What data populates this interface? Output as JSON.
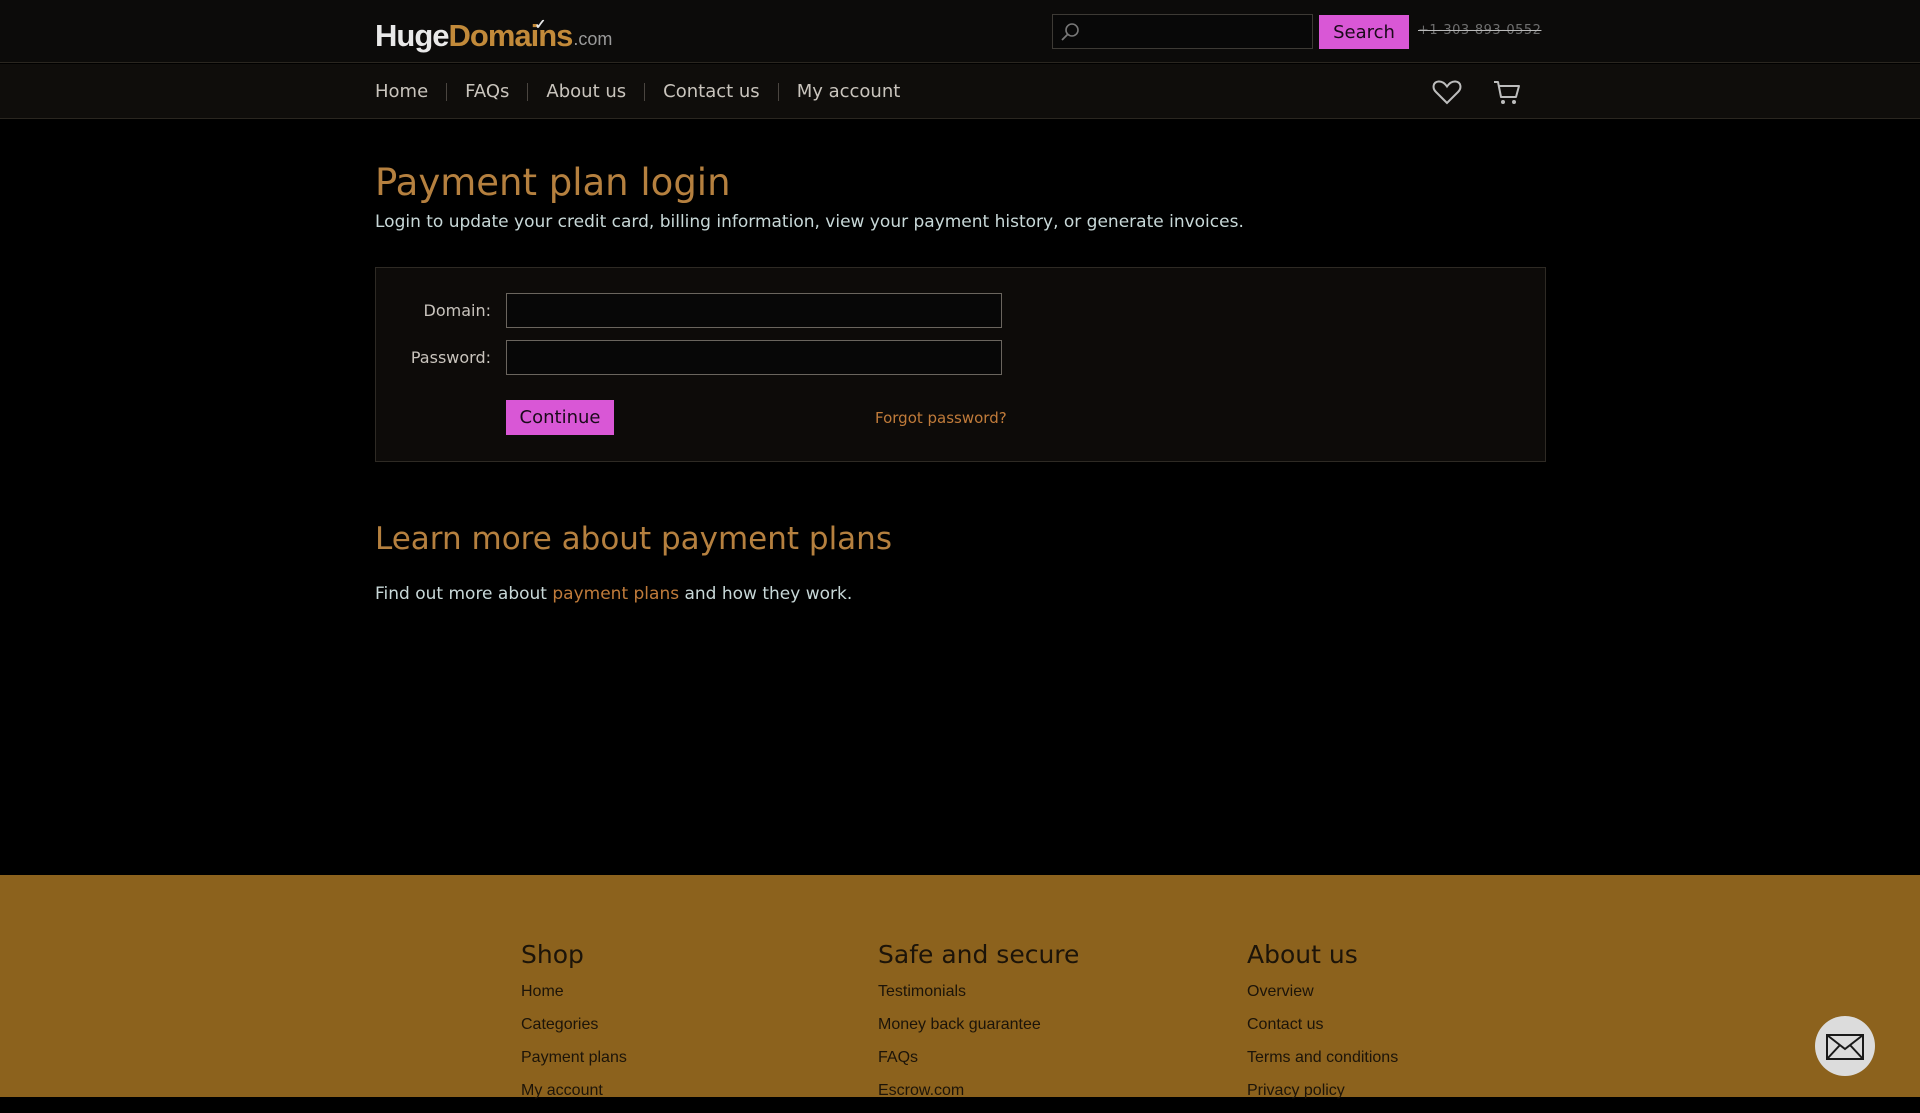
{
  "header": {
    "logo": {
      "huge": "Huge",
      "domains": "Domains",
      "com": ".com"
    },
    "search": {
      "placeholder": "",
      "button_label": "Search"
    },
    "phone": "+1-303-893-0552"
  },
  "nav": {
    "items": [
      {
        "label": "Home"
      },
      {
        "label": "FAQs"
      },
      {
        "label": "About us"
      },
      {
        "label": "Contact us"
      },
      {
        "label": "My account"
      }
    ],
    "icons": [
      "heart-icon",
      "cart-icon"
    ]
  },
  "main": {
    "title": "Payment plan login",
    "intro": "Login to update your credit card, billing information, view your payment history, or generate invoices.",
    "form": {
      "domain_label": "Domain:",
      "domain_value": "",
      "password_label": "Password:",
      "password_value": "",
      "continue_label": "Continue",
      "forgot_label": "Forgot password?"
    },
    "learn_title": "Learn more about payment plans",
    "learn_prefix": "Find out more about ",
    "learn_link": "payment plans",
    "learn_suffix": " and how they work."
  },
  "footer": {
    "columns": [
      {
        "title": "Shop",
        "links": [
          "Home",
          "Categories",
          "Payment plans",
          "My account"
        ]
      },
      {
        "title": "Safe and secure",
        "links": [
          "Testimonials",
          "Money back guarantee",
          "FAQs",
          "Escrow.com"
        ]
      },
      {
        "title": "About us",
        "links": [
          "Overview",
          "Contact us",
          "Terms and conditions",
          "Privacy policy"
        ]
      }
    ]
  },
  "colors": {
    "accent_button": "#d957d6",
    "heading_gold": "#b5803f",
    "link_orange": "#c07b3a",
    "footer_bg": "#8c621d"
  }
}
